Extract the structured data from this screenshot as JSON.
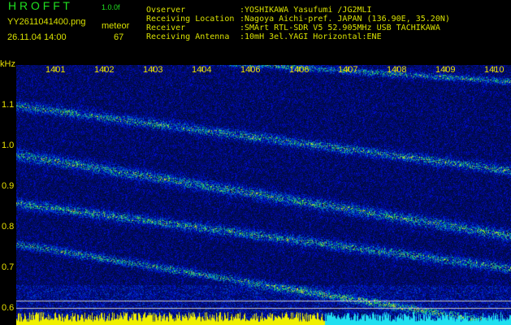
{
  "header": {
    "app_title": "H R O F F T",
    "version": "1.0.0f",
    "filename": "YY2611041400.png",
    "datetime": "26.11.04 14:00",
    "meteor_label": "meteor",
    "meteor_count": "67"
  },
  "info": [
    {
      "label": "Ovserver",
      "value": ":YOSHIKAWA Yasufumi /JG2MLI"
    },
    {
      "label": "Receiving Location",
      "value": ":Nagoya Aichi-pref. JAPAN (136.90E, 35.20N)"
    },
    {
      "label": "Receiver",
      "value": ":SMArt RTL-SDR V5 52.905MHz USB TACHIKAWA"
    },
    {
      "label": "Receiving Antenna",
      "value": ":10mH 3el.YAGI Horizontal:ENE"
    }
  ],
  "axes": {
    "y_unit": "kHz",
    "x_ticks": [
      "1401",
      "1402",
      "1403",
      "1404",
      "1406",
      "1406",
      "1407",
      "1408",
      "1409",
      "1410"
    ],
    "y_ticks": [
      "1.1",
      "1.0",
      "0.9",
      "0.8",
      "0.7",
      "0.6"
    ]
  },
  "colors": {
    "text": "#d8e000",
    "title": "#20e020",
    "background": "#000000",
    "noise": "#10208a"
  }
}
